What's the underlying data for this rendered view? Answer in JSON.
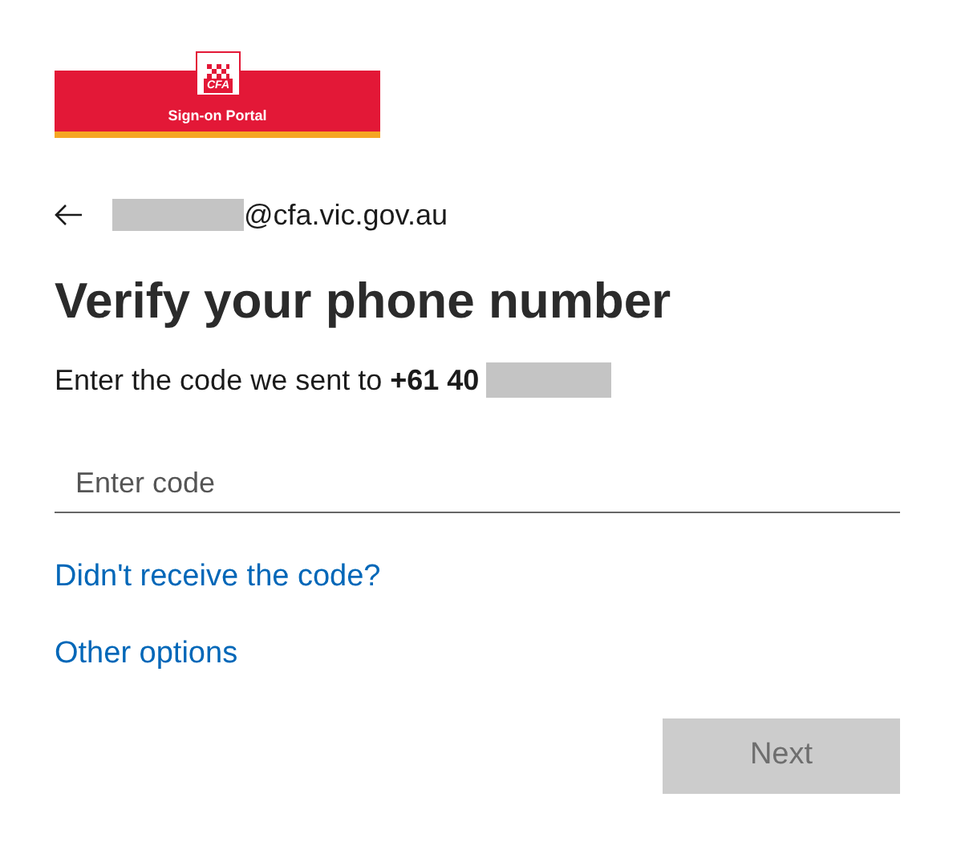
{
  "logo": {
    "emblem_text": "CFA",
    "caption": "Sign-on Portal"
  },
  "account": {
    "email_suffix": "@cfa.vic.gov.au"
  },
  "title": "Verify your phone number",
  "instruction": {
    "text": "Enter the code we sent to ",
    "phone": "+61 40"
  },
  "code_field": {
    "placeholder": "Enter code"
  },
  "links": [
    "Didn't receive the code?",
    "Other options"
  ],
  "next_button": {
    "label": "Next",
    "disabled": true
  }
}
